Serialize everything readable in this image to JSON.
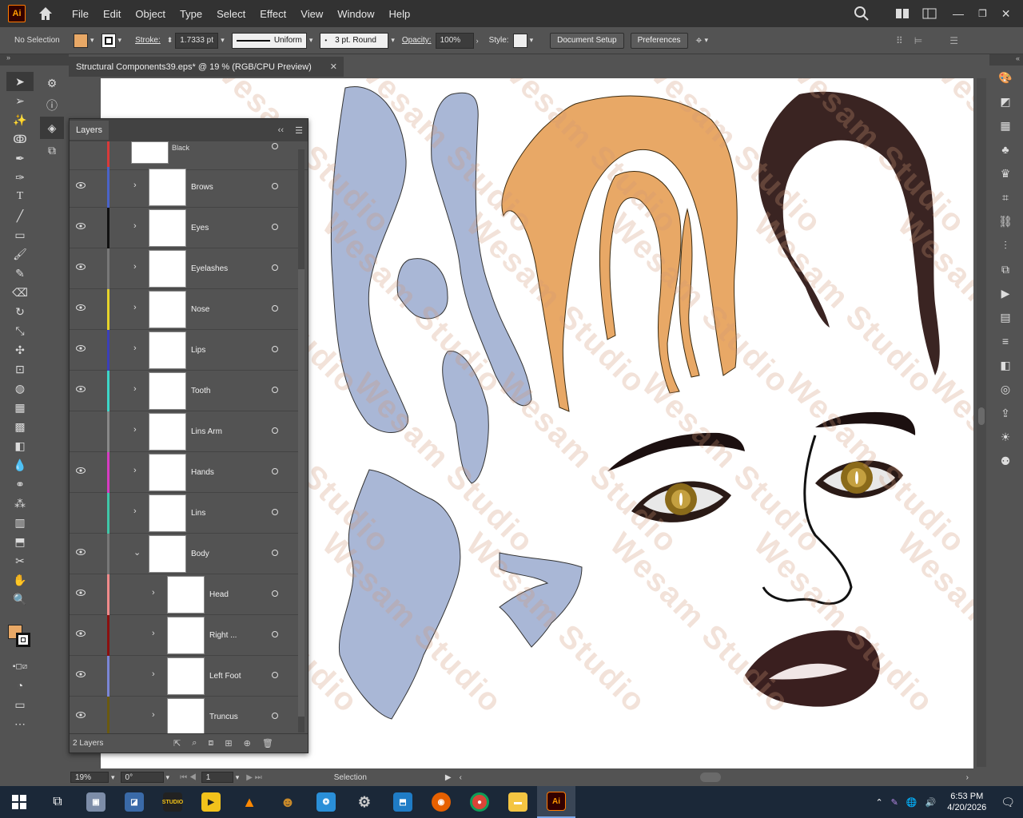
{
  "menubar": {
    "app_logo": "Ai",
    "items": [
      "File",
      "Edit",
      "Object",
      "Type",
      "Select",
      "Effect",
      "View",
      "Window",
      "Help"
    ]
  },
  "control": {
    "selection": "No Selection",
    "stroke_label": "Stroke:",
    "stroke_value": "1.7333 pt",
    "profile": "Uniform",
    "brush": "3 pt. Round",
    "opacity_label": "Opacity:",
    "opacity_value": "100%",
    "style_label": "Style:",
    "document_setup": "Document Setup",
    "preferences": "Preferences",
    "fill_color": "#e8a866"
  },
  "document": {
    "tab_title": "Structural Components39.eps* @ 19 % (RGB/CPU Preview)",
    "watermark": "Wesam Studio"
  },
  "layers_panel": {
    "title": "Layers",
    "partial_top": "Black",
    "footer": "2 Layers",
    "rows": [
      {
        "name": "Brows",
        "color": "#4a63c8",
        "visible": true,
        "expanded": false,
        "sub": false
      },
      {
        "name": "Eyes",
        "color": "#111111",
        "visible": true,
        "expanded": false,
        "sub": false
      },
      {
        "name": "Eyelashes",
        "color": "#777777",
        "visible": true,
        "expanded": false,
        "sub": false
      },
      {
        "name": "Nose",
        "color": "#e6d32a",
        "visible": true,
        "expanded": false,
        "sub": false
      },
      {
        "name": "Lips",
        "color": "#3b3fb8",
        "visible": true,
        "expanded": false,
        "sub": false
      },
      {
        "name": "Tooth",
        "color": "#3dd6c8",
        "visible": true,
        "expanded": false,
        "sub": false
      },
      {
        "name": "Lins Arm",
        "color": "#888888",
        "visible": false,
        "expanded": false,
        "sub": false
      },
      {
        "name": "Hands",
        "color": "#d63cc2",
        "visible": true,
        "expanded": false,
        "sub": false
      },
      {
        "name": "Lins",
        "color": "#3fc7a8",
        "visible": false,
        "expanded": false,
        "sub": false
      },
      {
        "name": "Body",
        "color": "#777777",
        "visible": true,
        "expanded": true,
        "sub": false
      },
      {
        "name": "Head",
        "color": "#f08a8a",
        "visible": true,
        "expanded": false,
        "sub": true
      },
      {
        "name": "Right ...",
        "color": "#8a1010",
        "visible": true,
        "expanded": false,
        "sub": true
      },
      {
        "name": "Left Foot",
        "color": "#7a86d6",
        "visible": true,
        "expanded": false,
        "sub": true
      },
      {
        "name": "Truncus",
        "color": "#6a5a10",
        "visible": true,
        "expanded": false,
        "sub": true
      }
    ]
  },
  "status": {
    "zoom": "19%",
    "rotation": "0°",
    "artboard": "1",
    "tool": "Selection"
  },
  "taskbar": {
    "time": "6:53 PM",
    "date": "4/20/2026"
  }
}
